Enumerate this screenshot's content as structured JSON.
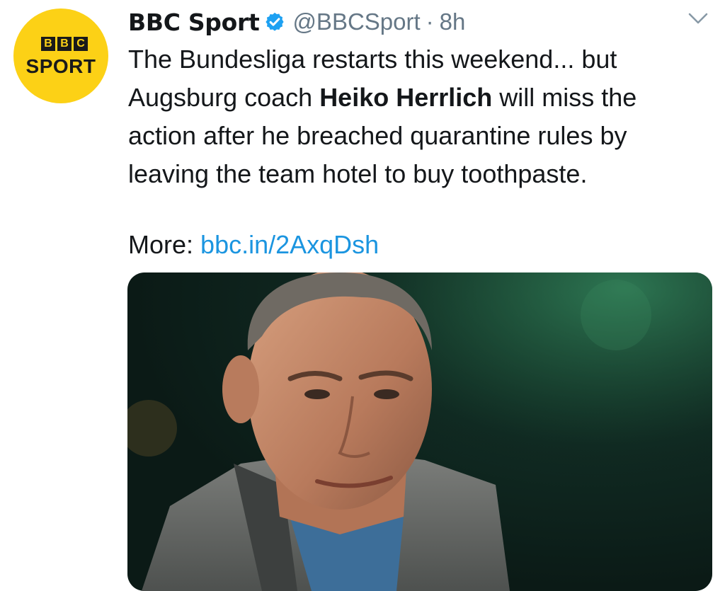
{
  "author": {
    "name": "BBC Sport",
    "handle": "@BBCSport",
    "separator": "·",
    "time": "8h",
    "avatar_logo_text": "BBC SPORT",
    "avatar_letters": [
      "B",
      "B",
      "C"
    ],
    "avatar_word": "SPORT",
    "verified_icon": "verified-badge-icon"
  },
  "tweet": {
    "text_before": "The Bundesliga restarts this weekend... but\nAugsburg coach ",
    "text_bold": "Heiko Herrlich",
    "text_after": " will miss the\naction after he breached quarantine rules by\nleaving the team hotel to buy toothpaste.",
    "more_label": "More:",
    "link": "bbc.in/2AxqDsh"
  },
  "menu_icon": "chevron-down-icon",
  "colors": {
    "brand_yellow": "#fcd116",
    "link_blue": "#1b95e0",
    "verified_blue": "#1da1f2",
    "muted_gray": "#657786"
  }
}
